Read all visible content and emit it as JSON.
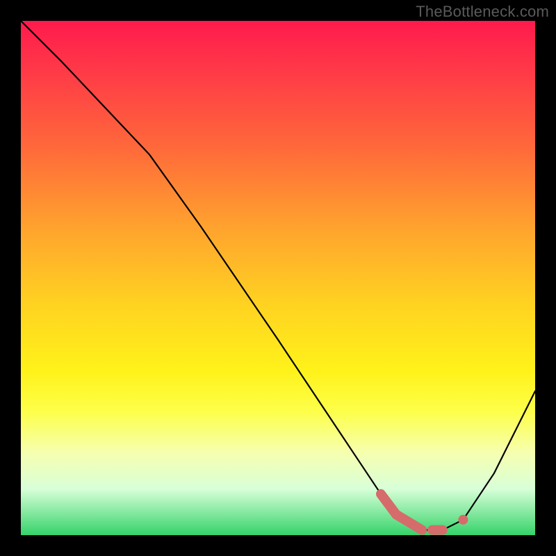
{
  "watermark": "TheBottleneck.com",
  "chart_data": {
    "type": "line",
    "title": "",
    "xlabel": "",
    "ylabel": "",
    "xlim": [
      0,
      100
    ],
    "ylim": [
      0,
      100
    ],
    "grid": false,
    "legend": false,
    "background_gradient": {
      "top": "#ff1a4d",
      "middle": "#ffe81a",
      "bottom": "#35d36a"
    },
    "series": [
      {
        "name": "curve",
        "x": [
          0,
          8,
          25,
          35,
          50,
          62,
          70,
          73,
          78,
          82,
          86,
          92,
          100
        ],
        "y": [
          100,
          92,
          74,
          60,
          38,
          20,
          8,
          4,
          1,
          1,
          3,
          12,
          28
        ],
        "stroke": "#000000"
      }
    ],
    "highlighted_segment": {
      "name": "optimal-zone",
      "color": "#d66b6b",
      "segments": [
        {
          "x": [
            70,
            73,
            78
          ],
          "y": [
            8,
            4,
            1
          ]
        },
        {
          "x": [
            80,
            82
          ],
          "y": [
            1,
            1
          ]
        }
      ],
      "points": [
        {
          "x": 86,
          "y": 3
        }
      ]
    }
  }
}
